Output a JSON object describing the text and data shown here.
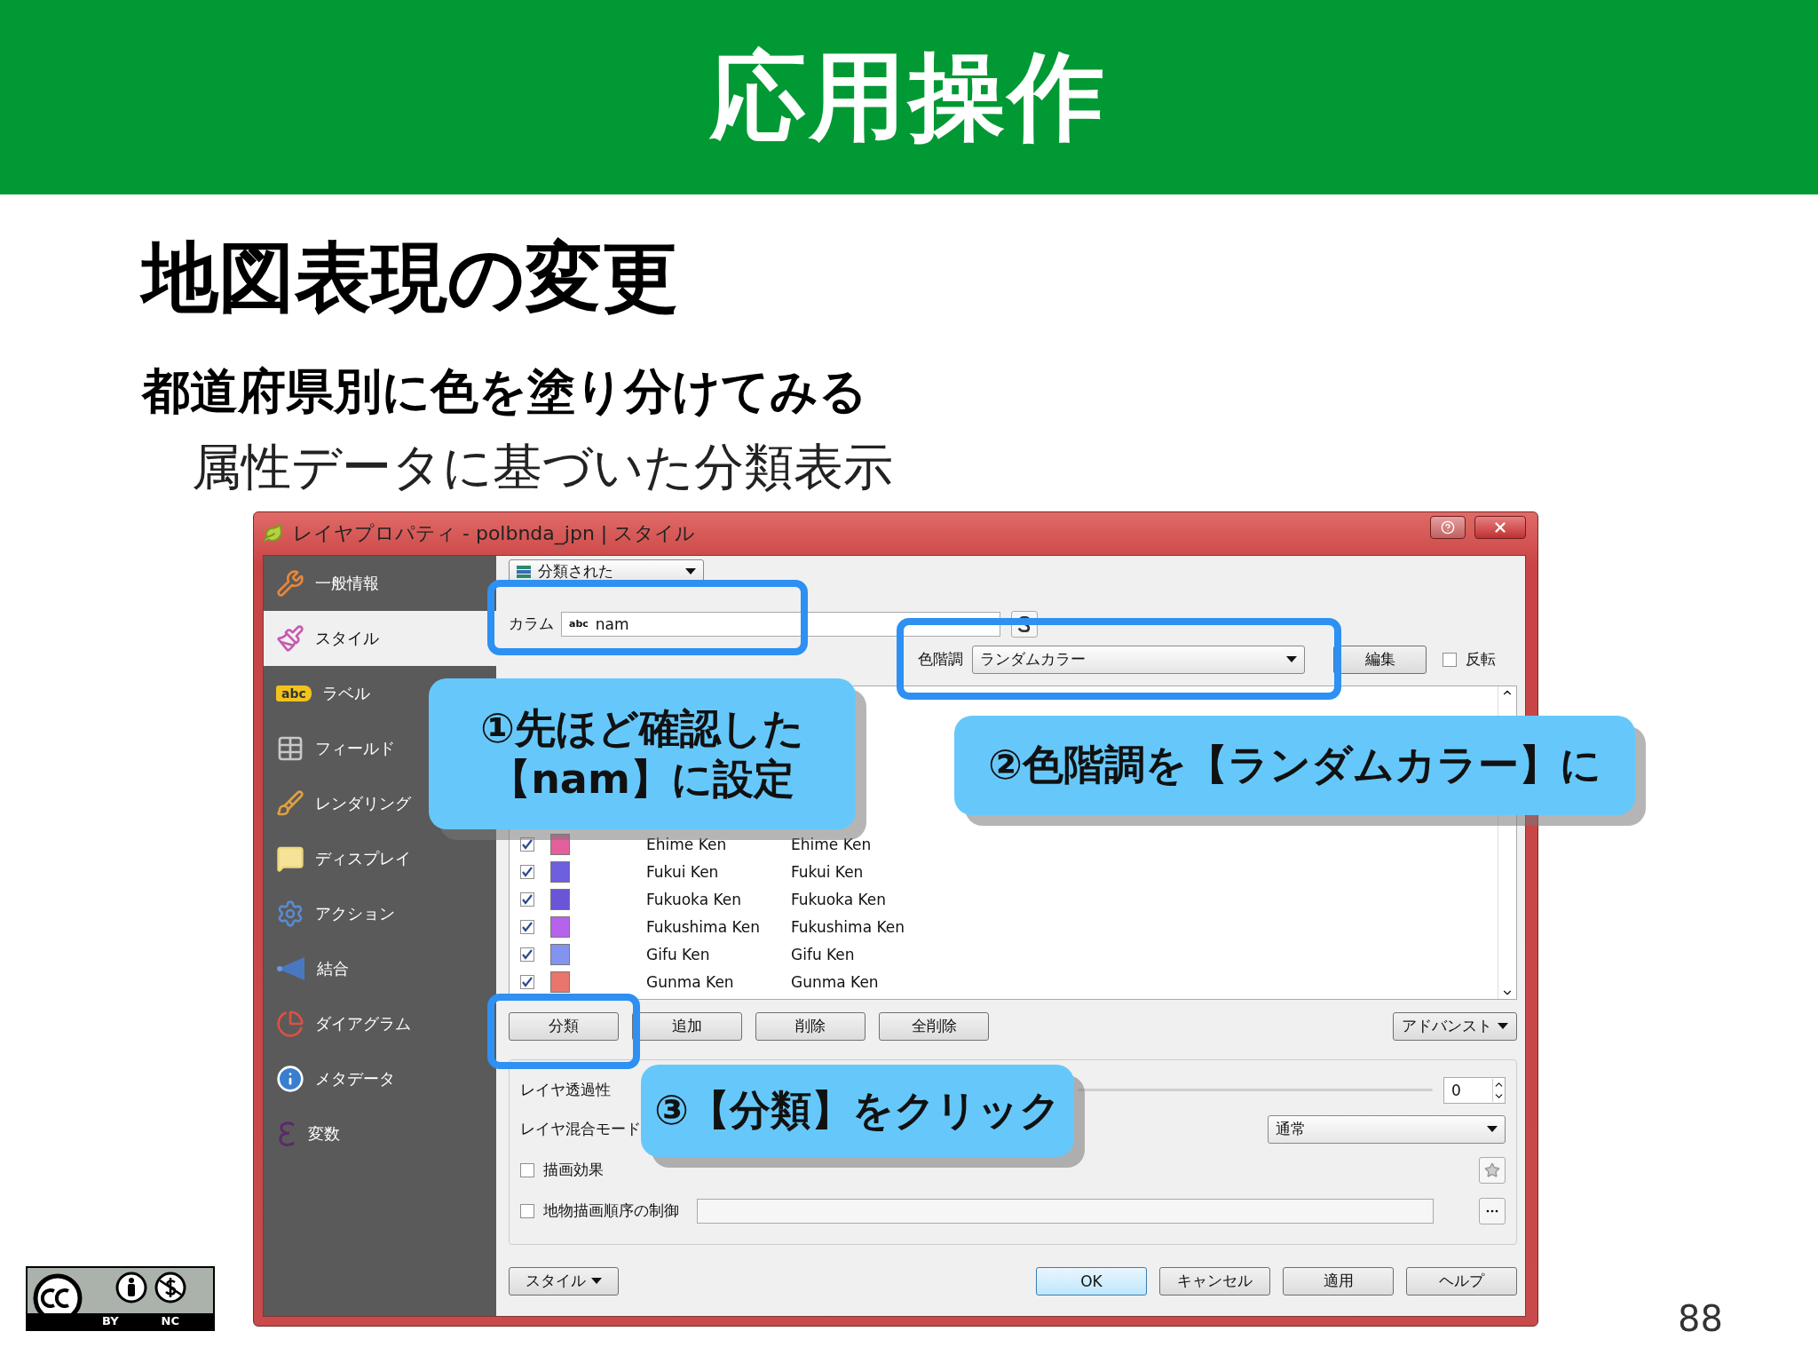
{
  "header": {
    "title": "応用操作"
  },
  "heading": "地図表現の変更",
  "subheading": "都道府県別に色を塗り分けてみる",
  "description": "属性データに基づいた分類表示",
  "dialog": {
    "title": "レイヤプロパティ - polbnda_jpn | スタイル",
    "sidebar": [
      {
        "label": "一般情報",
        "selected": false
      },
      {
        "label": "スタイル",
        "selected": true
      },
      {
        "label": "ラベル",
        "icon_text": "abc",
        "selected": false
      },
      {
        "label": "フィールド",
        "selected": false
      },
      {
        "label": "レンダリング",
        "selected": false
      },
      {
        "label": "ディスプレイ",
        "selected": false
      },
      {
        "label": "アクション",
        "selected": false
      },
      {
        "label": "結合",
        "selected": false
      },
      {
        "label": "ダイアグラム",
        "selected": false
      },
      {
        "label": "メタデータ",
        "selected": false
      },
      {
        "label": "変数",
        "selected": false
      }
    ],
    "renderer": "分類された",
    "column_label": "カラム",
    "column_type": "abc",
    "column_value": "nam",
    "ramp_label": "色階調",
    "ramp_value": "ランダムカラー",
    "edit_button": "編集",
    "invert": {
      "label": "反転",
      "checked": false
    },
    "classes": [
      {
        "checked": true,
        "color": "#e4609c",
        "value": "Ehime Ken",
        "legend": "Ehime Ken"
      },
      {
        "checked": true,
        "color": "#6e5ee0",
        "value": "Fukui Ken",
        "legend": "Fukui Ken"
      },
      {
        "checked": true,
        "color": "#6a55d6",
        "value": "Fukuoka Ken",
        "legend": "Fukuoka Ken"
      },
      {
        "checked": true,
        "color": "#b662ea",
        "value": "Fukushima Ken",
        "legend": "Fukushima Ken"
      },
      {
        "checked": true,
        "color": "#8394f0",
        "value": "Gifu Ken",
        "legend": "Gifu Ken"
      },
      {
        "checked": true,
        "color": "#e8766c",
        "value": "Gunma Ken",
        "legend": "Gunma Ken"
      }
    ],
    "list_buttons": [
      "分類",
      "追加",
      "削除",
      "全削除"
    ],
    "advanced_button": "アドバンスト",
    "rendering": {
      "opacity_label": "レイヤ透過性",
      "opacity_value": "0",
      "blend_label": "レイヤ混合モード",
      "feature_blend_value": "通常",
      "effects": {
        "label": "描画効果",
        "checked": false
      },
      "order": {
        "label": "地物描画順序の制御",
        "checked": false
      }
    },
    "style_button": "スタイル",
    "buttons": [
      {
        "label": "OK",
        "default": true
      },
      {
        "label": "キャンセル",
        "default": false
      },
      {
        "label": "適用",
        "default": false
      },
      {
        "label": "ヘルプ",
        "default": false
      }
    ]
  },
  "callouts": [
    {
      "lines": [
        "①先ほど確認した",
        "【nam】に設定"
      ]
    },
    {
      "lines": [
        "②色階調を【ランダムカラー】に"
      ]
    },
    {
      "lines": [
        "③【分類】をクリック"
      ]
    }
  ],
  "license": {
    "by": "BY",
    "nc": "NC"
  },
  "page_number": "88"
}
